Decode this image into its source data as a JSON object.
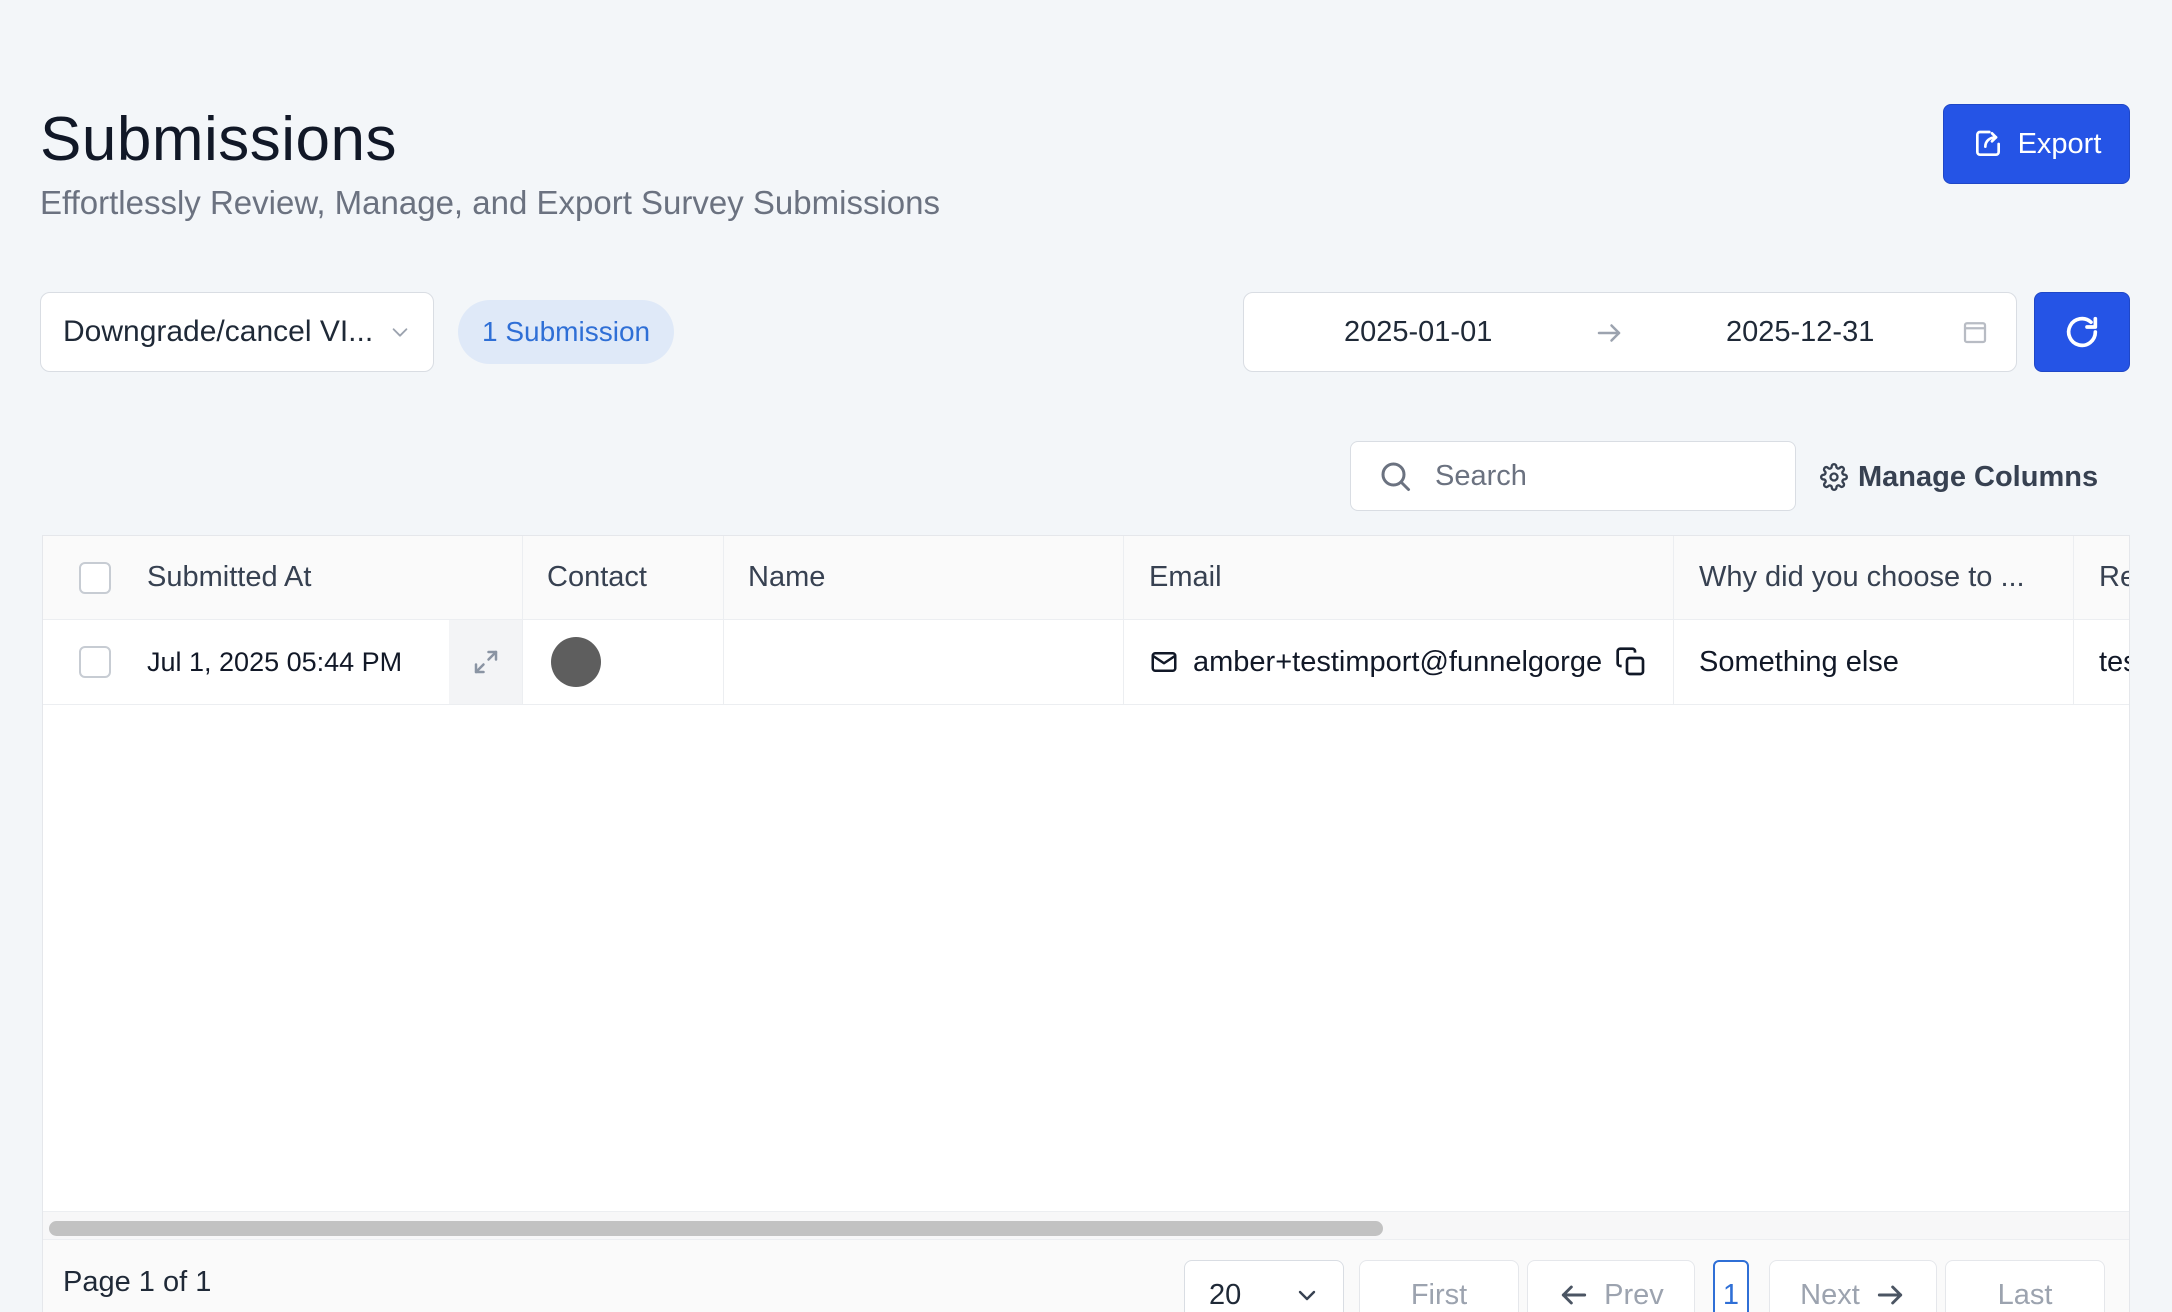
{
  "header": {
    "title": "Submissions",
    "subtitle": "Effortlessly Review, Manage, and Export Survey Submissions",
    "export_label": "Export"
  },
  "filters": {
    "survey_selected": "Downgrade/cancel VI...",
    "submission_count": "1 Submission",
    "date_start": "2025-01-01",
    "date_end": "2025-12-31"
  },
  "toolbar": {
    "search_placeholder": "Search",
    "manage_columns_label": "Manage Columns"
  },
  "table": {
    "columns": [
      "Submitted At",
      "Contact",
      "Name",
      "Email",
      "Why did you choose to ...",
      "Re"
    ],
    "rows": [
      {
        "submitted_at": "Jul 1, 2025  05:44 PM",
        "name": "",
        "email": "amber+testimport@funnelgorge",
        "why": "Something else",
        "re": "tes"
      }
    ]
  },
  "pagination": {
    "page_info": "Page 1 of 1",
    "page_size": "20",
    "first_label": "First",
    "prev_label": "Prev",
    "current_page": "1",
    "next_label": "Next",
    "last_label": "Last"
  },
  "colors": {
    "primary": "#2554e6",
    "badge_bg": "#dfe9f8",
    "badge_text": "#2f6fd6",
    "page_bg": "#f3f6f9"
  },
  "icons": [
    "export-icon",
    "chevron-down-icon",
    "arrow-right-icon",
    "calendar-icon",
    "refresh-icon",
    "search-icon",
    "gear-icon",
    "expand-icon",
    "mail-icon",
    "copy-icon",
    "arrow-left-icon"
  ]
}
